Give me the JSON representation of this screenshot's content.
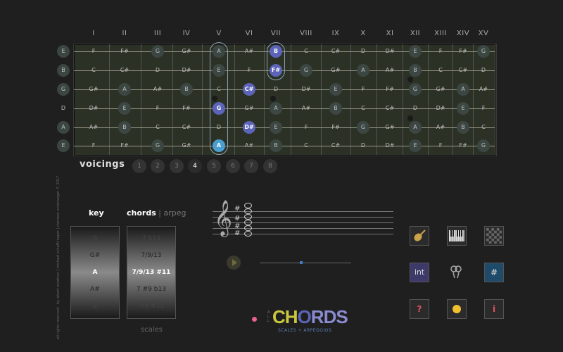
{
  "fretboard": {
    "fret_numbers": [
      "I",
      "II",
      "III",
      "IV",
      "V",
      "VI",
      "VII",
      "VIII",
      "IX",
      "X",
      "XI",
      "XII",
      "XIII",
      "XIV",
      "XV"
    ],
    "strings": [
      {
        "open": "E",
        "notes": [
          "F",
          "F#",
          "G",
          "G#",
          "A",
          "A#",
          "B",
          "C",
          "C#",
          "D",
          "D#",
          "E",
          "F",
          "F#",
          "G"
        ]
      },
      {
        "open": "B",
        "notes": [
          "C",
          "C#",
          "D",
          "D#",
          "E",
          "F",
          "F#",
          "G",
          "G#",
          "A",
          "A#",
          "B",
          "C",
          "C#",
          "D"
        ]
      },
      {
        "open": "G",
        "notes": [
          "G#",
          "A",
          "A#",
          "B",
          "C",
          "C#",
          "D",
          "D#",
          "E",
          "F",
          "F#",
          "G",
          "G#",
          "A",
          "A#"
        ]
      },
      {
        "open": "D",
        "notes": [
          "D#",
          "E",
          "F",
          "F#",
          "G",
          "G#",
          "A",
          "A#",
          "B",
          "C",
          "C#",
          "D",
          "D#",
          "E",
          "F"
        ]
      },
      {
        "open": "A",
        "notes": [
          "A#",
          "B",
          "C",
          "C#",
          "D",
          "D#",
          "E",
          "F",
          "F#",
          "G",
          "G#",
          "A",
          "A#",
          "B",
          "C"
        ]
      },
      {
        "open": "E",
        "notes": [
          "F",
          "F#",
          "G",
          "G#",
          "A",
          "A#",
          "B",
          "C",
          "C#",
          "D",
          "D#",
          "E",
          "F",
          "F#",
          "G"
        ]
      }
    ],
    "chord_notes": [
      {
        "string": 0,
        "fret": 7,
        "label": "B",
        "kind": "chord"
      },
      {
        "string": 1,
        "fret": 7,
        "label": "F#",
        "kind": "chord"
      },
      {
        "string": 2,
        "fret": 6,
        "label": "C#",
        "kind": "chord"
      },
      {
        "string": 3,
        "fret": 5,
        "label": "G",
        "kind": "chord"
      },
      {
        "string": 4,
        "fret": 6,
        "label": "D#",
        "kind": "chord"
      },
      {
        "string": 5,
        "fret": 5,
        "label": "A",
        "kind": "root"
      }
    ]
  },
  "voicings": {
    "label": "voicings",
    "items": [
      "1",
      "2",
      "3",
      "4",
      "5",
      "6",
      "7",
      "8"
    ],
    "active": 3
  },
  "copyright": "all rights reserved · by albert wiedmer | michael schaffrinaper | clemens unterweger © 2017",
  "key_wheel": {
    "title": "key",
    "items": [
      "G",
      "G#",
      "A",
      "A#",
      "B"
    ],
    "selected": 2
  },
  "chords_wheel": {
    "title": "chords",
    "alt_title": "arpeg",
    "items": [
      "7 b13",
      "7/9/13",
      "7/9/13 #11",
      "7 #9 b13",
      "7/9 #11"
    ],
    "selected": 2
  },
  "scales_label": "scales",
  "staff": {
    "clef": "𝄞",
    "sharp": "#"
  },
  "player": {
    "progress": 0.45
  },
  "tools": [
    {
      "name": "guitar-icon",
      "label": "🎸",
      "color": "#c9a24a",
      "bg": "#2b2b2b"
    },
    {
      "name": "piano-icon",
      "label": "",
      "color": "#ccc",
      "bg": "#2b2b2b"
    },
    {
      "name": "checker-icon",
      "label": "",
      "color": "#888",
      "bg": "#2b2b2b"
    },
    {
      "name": "interval-button",
      "label": "int",
      "color": "#ddd",
      "bg": "#3d3a6a"
    },
    {
      "name": "finger-icon",
      "label": "",
      "color": "#aaa",
      "bg": "transparent"
    },
    {
      "name": "sharp-button",
      "label": "#",
      "color": "#ddd",
      "bg": "#1f4a6a"
    },
    {
      "name": "help-button",
      "label": "?",
      "color": "#e05060",
      "bg": "#2b2b2b"
    },
    {
      "name": "color-button",
      "label": "",
      "color": "#f0c030",
      "bg": "#2b2b2b"
    },
    {
      "name": "info-button",
      "label": "i",
      "color": "#e05060",
      "bg": "#2b2b2b"
    }
  ],
  "logo": {
    "all": "A L L",
    "main": "CHORDS",
    "sub": "SCALES + ARPEGGIOS",
    "colors": {
      "ch": "#c8c840",
      "o": "#5b64b8",
      "rds": "#8a8ad0"
    }
  }
}
